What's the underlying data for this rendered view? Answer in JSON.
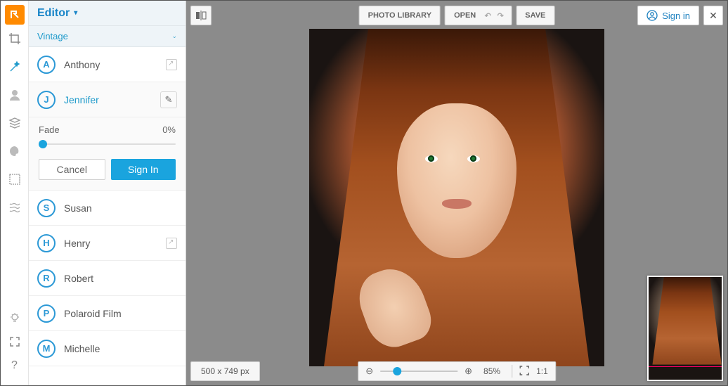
{
  "app": {
    "title": "Editor",
    "category": "Vintage"
  },
  "toolbar": {
    "photo_library": "PHOTO LIBRARY",
    "open": "OPEN",
    "save": "SAVE",
    "sign_in": "Sign in"
  },
  "presets": [
    {
      "letter": "A",
      "label": "Anthony",
      "has_open": true
    },
    {
      "letter": "J",
      "label": "Jennifer",
      "selected": true
    },
    {
      "letter": "S",
      "label": "Susan"
    },
    {
      "letter": "H",
      "label": "Henry",
      "has_open": true
    },
    {
      "letter": "R",
      "label": "Robert"
    },
    {
      "letter": "P",
      "label": "Polaroid Film"
    },
    {
      "letter": "M",
      "label": "Michelle"
    }
  ],
  "fade": {
    "label": "Fade",
    "value": "0%"
  },
  "actions": {
    "cancel": "Cancel",
    "sign_in": "Sign In"
  },
  "canvas": {
    "dimensions": "500 x 749 px"
  },
  "zoom": {
    "percent": "85%",
    "one_to_one": "1:1"
  }
}
